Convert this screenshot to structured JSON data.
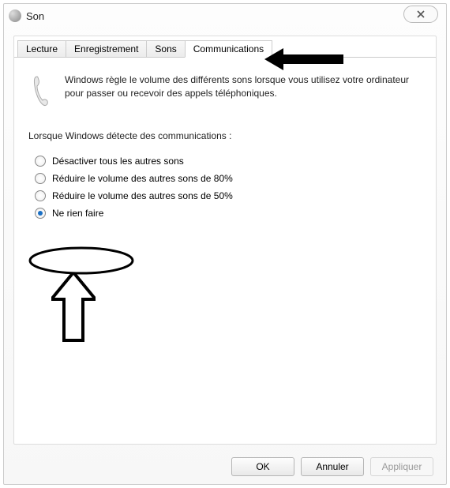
{
  "window": {
    "title": "Son"
  },
  "tabs": {
    "0": {
      "label": "Lecture"
    },
    "1": {
      "label": "Enregistrement"
    },
    "2": {
      "label": "Sons"
    },
    "3": {
      "label": "Communications"
    }
  },
  "panel": {
    "description": "Windows règle le volume des différents sons lorsque vous utilisez votre ordinateur pour passer ou recevoir des appels téléphoniques.",
    "subtitle": "Lorsque Windows détecte des communications :",
    "options": {
      "0": {
        "label": "Désactiver tous les autres sons"
      },
      "1": {
        "label": "Réduire le volume des autres sons de 80%"
      },
      "2": {
        "label": "Réduire le volume des autres sons de 50%"
      },
      "3": {
        "label": "Ne rien faire"
      }
    }
  },
  "buttons": {
    "ok": "OK",
    "cancel": "Annuler",
    "apply": "Appliquer"
  }
}
